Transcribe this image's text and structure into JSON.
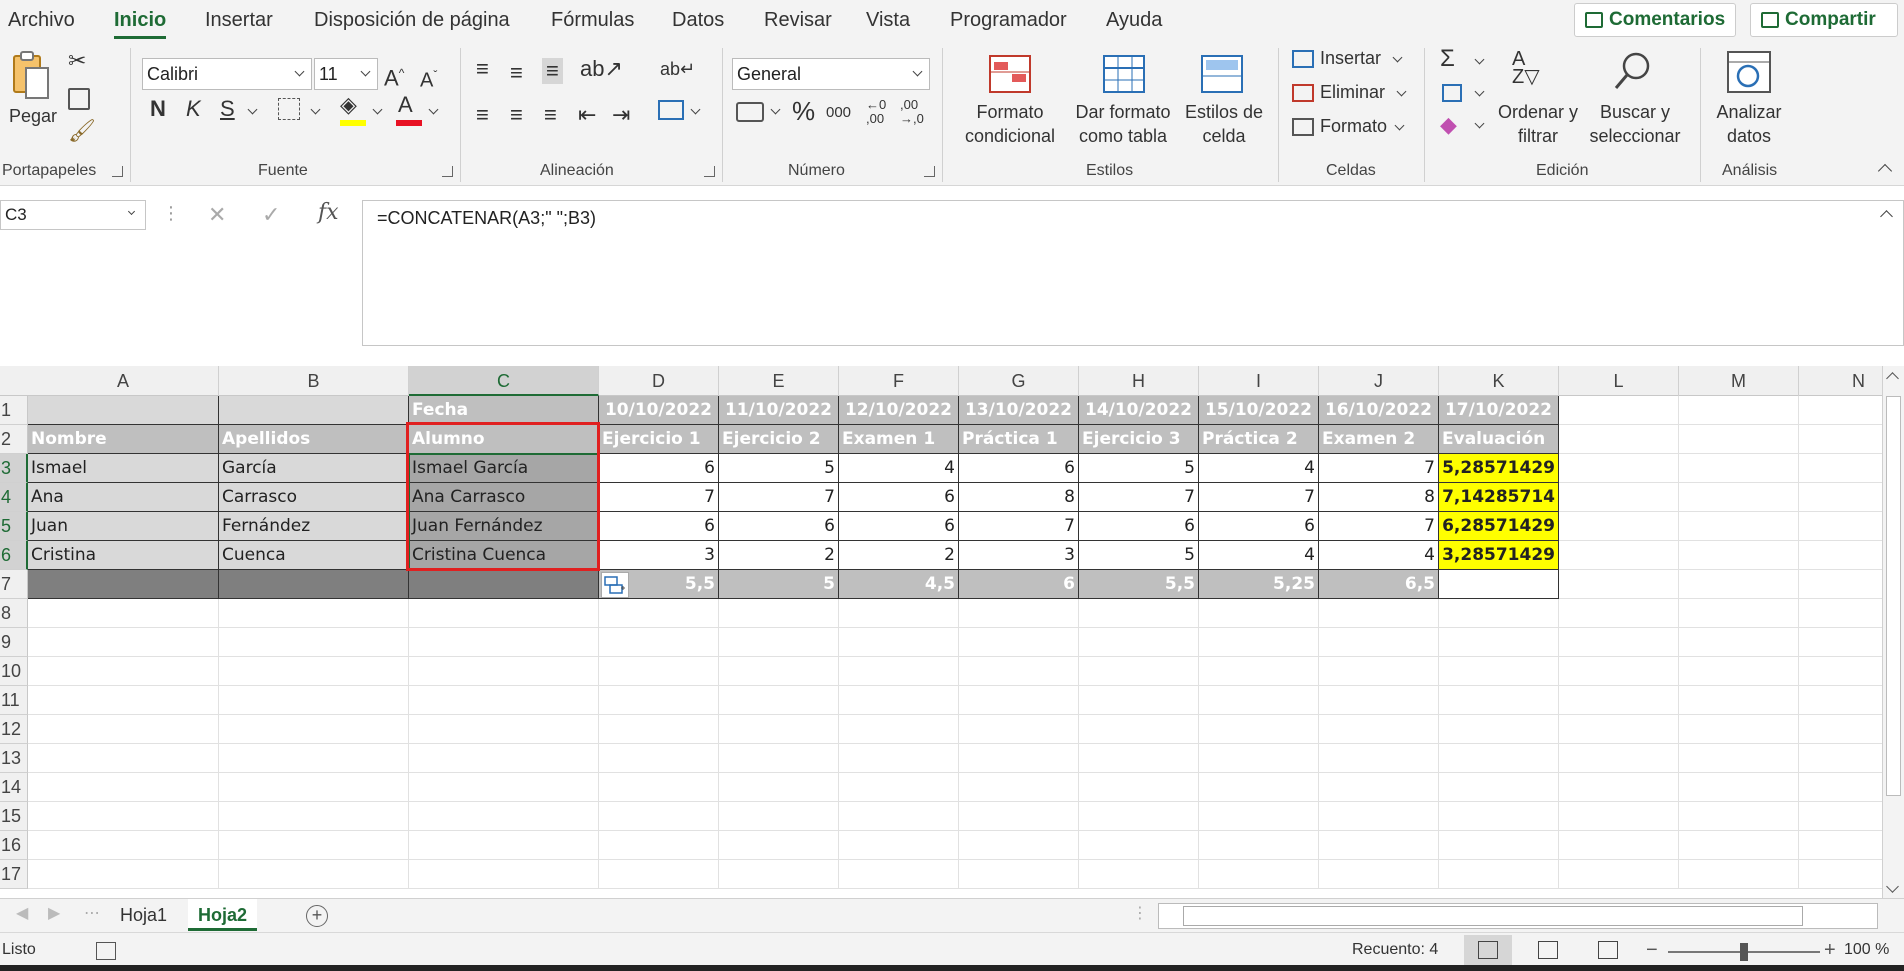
{
  "menu": {
    "tabs": [
      "Archivo",
      "Inicio",
      "Insertar",
      "Disposición de página",
      "Fórmulas",
      "Datos",
      "Revisar",
      "Vista",
      "Programador",
      "Ayuda"
    ],
    "active_tab": "Inicio",
    "comments_label": "Comentarios",
    "share_label": "Compartir"
  },
  "ribbon": {
    "clipboard": {
      "paste_label": "Pegar",
      "group_label": "Portapapeles"
    },
    "font": {
      "font_name": "Calibri",
      "font_size": "11",
      "bold_label": "N",
      "italic_label": "K",
      "underline_label": "S",
      "group_label": "Fuente",
      "highlight_color": "#ffff00",
      "font_color": "#e81123"
    },
    "alignment": {
      "group_label": "Alineación"
    },
    "number": {
      "format": "General",
      "percent_label": "%",
      "thousands_label": "000",
      "group_label": "Número"
    },
    "styles": {
      "conditional_label_1": "Formato",
      "conditional_label_2": "condicional",
      "table_label_1": "Dar formato",
      "table_label_2": "como tabla",
      "cellstyles_label_1": "Estilos de",
      "cellstyles_label_2": "celda",
      "group_label": "Estilos"
    },
    "cells": {
      "insert_label": "Insertar",
      "delete_label": "Eliminar",
      "format_label": "Formato",
      "group_label": "Celdas"
    },
    "editing": {
      "sort_label_1": "Ordenar y",
      "sort_label_2": "filtrar",
      "find_label_1": "Buscar y",
      "find_label_2": "seleccionar",
      "group_label": "Edición"
    },
    "analysis": {
      "label_1": "Analizar",
      "label_2": "datos",
      "group_label": "Análisis"
    }
  },
  "formula_bar": {
    "name_box": "C3",
    "fx_label": "fx",
    "formula": "=CONCATENAR(A3;\" \";B3)"
  },
  "columns": [
    "A",
    "B",
    "C",
    "D",
    "E",
    "F",
    "G",
    "H",
    "I",
    "J",
    "K",
    "L",
    "M",
    "N"
  ],
  "rows": [
    "1",
    "2",
    "3",
    "4",
    "5",
    "6",
    "7",
    "8",
    "9",
    "10",
    "11",
    "12",
    "13",
    "14",
    "15",
    "16",
    "17"
  ],
  "sheet": {
    "r1": {
      "C": "Fecha",
      "D": "10/10/2022",
      "E": "11/10/2022",
      "F": "12/10/2022",
      "G": "13/10/2022",
      "H": "14/10/2022",
      "I": "15/10/2022",
      "J": "16/10/2022",
      "K": "17/10/2022"
    },
    "r2": {
      "A": "Nombre",
      "B": "Apellidos",
      "C": "Alumno",
      "D": "Ejercicio 1",
      "E": "Ejercicio 2",
      "F": "Examen 1",
      "G": "Práctica 1",
      "H": "Ejercicio 3",
      "I": "Práctica 2",
      "J": "Examen 2",
      "K": "Evaluación"
    },
    "r3": {
      "A": "Ismael",
      "B": "García",
      "C": "Ismael García",
      "D": "6",
      "E": "5",
      "F": "4",
      "G": "6",
      "H": "5",
      "I": "4",
      "J": "7",
      "K": "5,28571429"
    },
    "r4": {
      "A": "Ana",
      "B": "Carrasco",
      "C": "Ana  Carrasco",
      "D": "7",
      "E": "7",
      "F": "6",
      "G": "8",
      "H": "7",
      "I": "7",
      "J": "8",
      "K": "7,14285714"
    },
    "r5": {
      "A": "Juan",
      "B": "Fernández",
      "C": "Juan Fernández",
      "D": "6",
      "E": "6",
      "F": "6",
      "G": "7",
      "H": "6",
      "I": "6",
      "J": "7",
      "K": "6,28571429"
    },
    "r6": {
      "A": "Cristina",
      "B": "Cuenca",
      "C": "Cristina  Cuenca",
      "D": "3",
      "E": "2",
      "F": "2",
      "G": "3",
      "H": "5",
      "I": "4",
      "J": "4",
      "K": "3,28571429"
    },
    "r7": {
      "D": "5,5",
      "E": "5",
      "F": "4,5",
      "G": "6",
      "H": "5,5",
      "I": "5,25",
      "J": "6,5"
    }
  },
  "tabs": {
    "sheets": [
      "Hoja1",
      "Hoja2"
    ],
    "active": "Hoja2"
  },
  "status": {
    "ready": "Listo",
    "count": "Recuento: 4",
    "zoom": "100 %"
  },
  "colors": {
    "accent": "#1e6b35",
    "highlight_box": "#e02020",
    "evaluation_fill": "#ffff00"
  }
}
